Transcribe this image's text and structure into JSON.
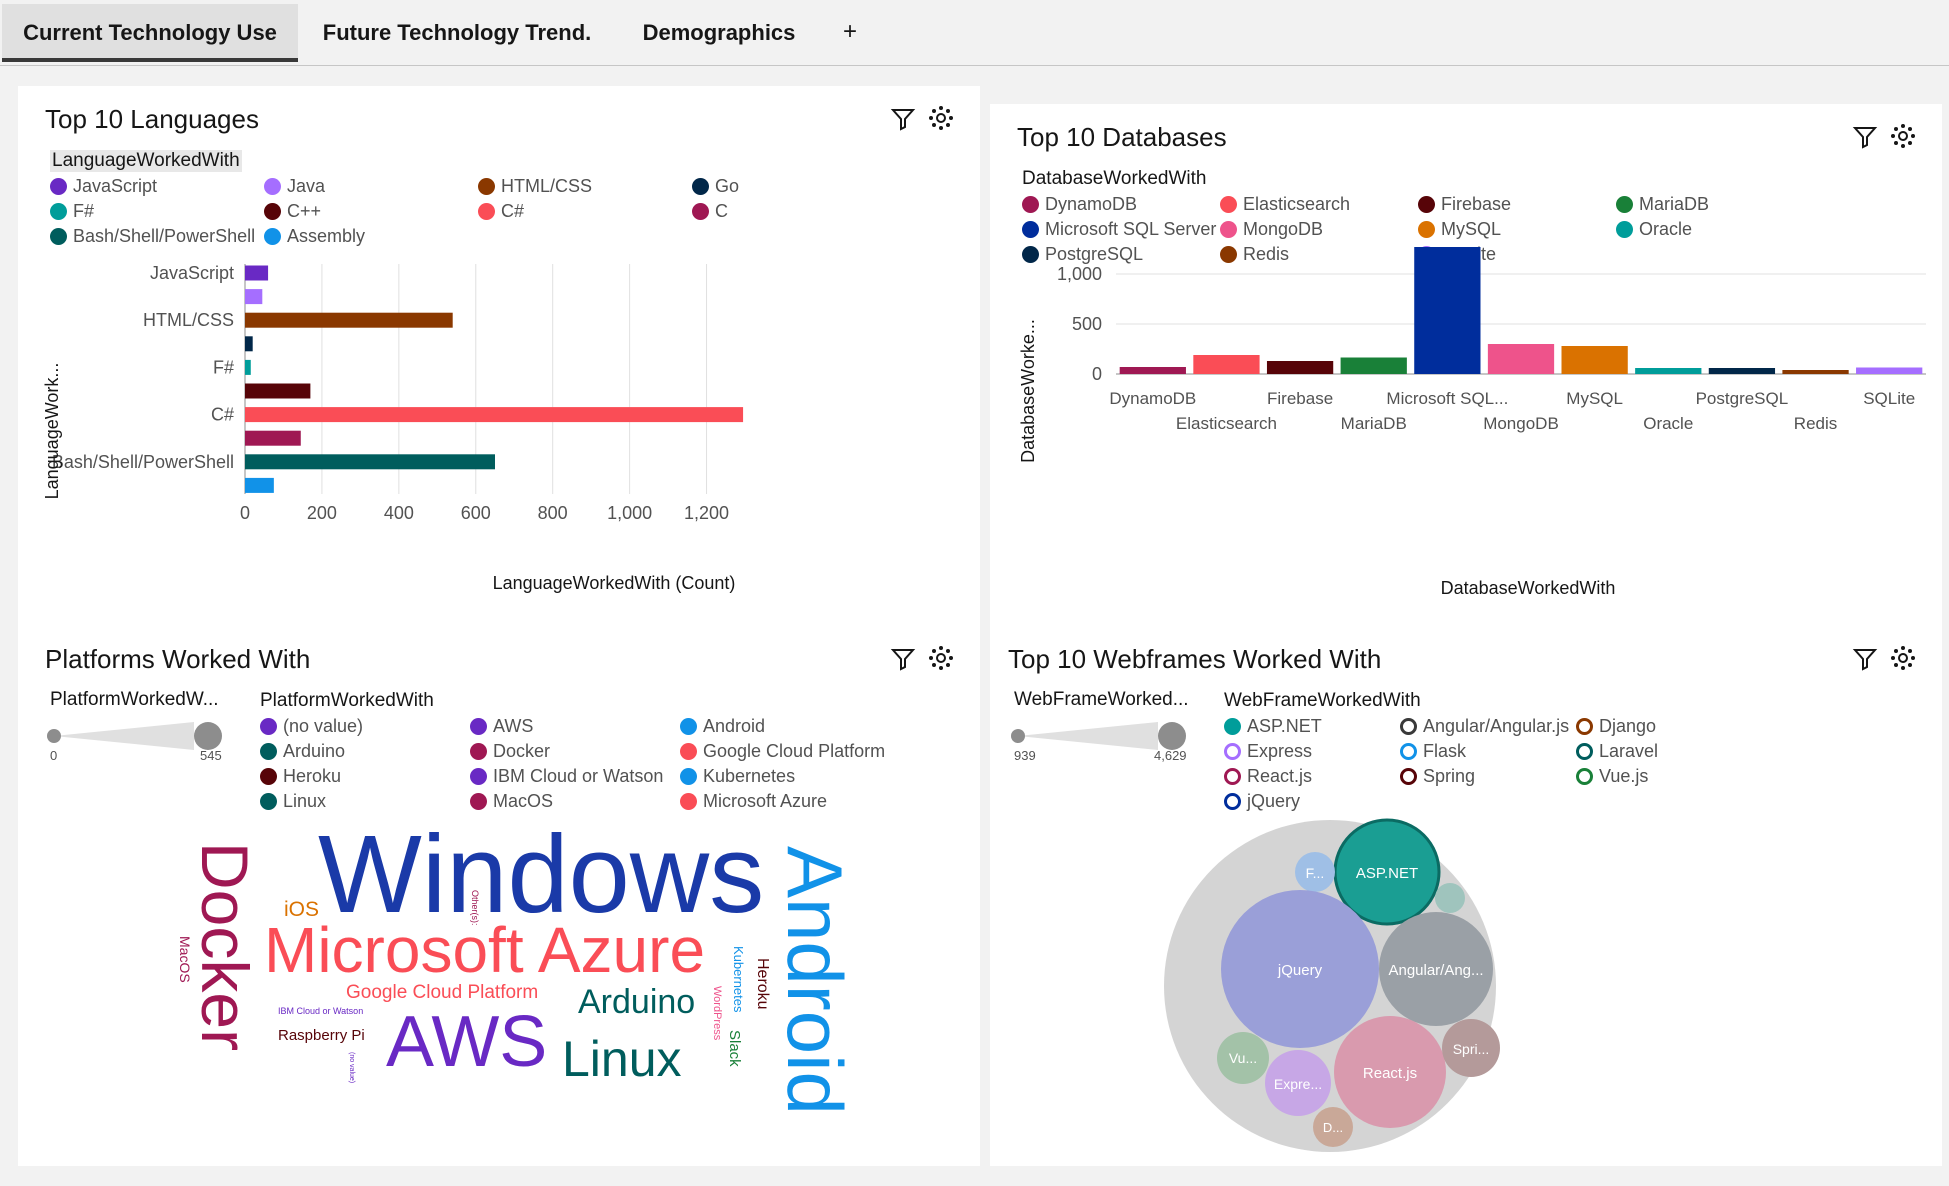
{
  "tabs": [
    {
      "label": "Current Technology Use",
      "active": true
    },
    {
      "label": "Future Technology Trend.",
      "active": false
    },
    {
      "label": "Demographics",
      "active": false
    }
  ],
  "add_tab_label": "+",
  "icons": {
    "filter": "filter-icon",
    "settings": "network-settings-icon"
  },
  "languages": {
    "title": "Top 10 Languages",
    "legend_title": "LanguageWorkedWith",
    "legend": [
      {
        "name": "JavaScript",
        "color": "#6929c4"
      },
      {
        "name": "Java",
        "color": "#a56eff"
      },
      {
        "name": "HTML/CSS",
        "color": "#8a3800"
      },
      {
        "name": "Go",
        "color": "#012749"
      },
      {
        "name": "F#",
        "color": "#1192e8"
      },
      {
        "name": "C++",
        "color": "#570408"
      },
      {
        "name": "C#",
        "color": "#fa4d56"
      },
      {
        "name": "C",
        "color": "#9f1853"
      },
      {
        "name": "Bash/Shell/PowerShell",
        "color": "#005d5d"
      },
      {
        "name": "Assembly",
        "color": "#1192e8"
      }
    ]
  },
  "databases": {
    "title": "Top 10 Databases",
    "legend_title": "DatabaseWorkedWith",
    "legend": [
      {
        "name": "DynamoDB",
        "color": "#9f1853"
      },
      {
        "name": "Elasticsearch",
        "color": "#fa4d56"
      },
      {
        "name": "Firebase",
        "color": "#570408"
      },
      {
        "name": "MariaDB",
        "color": "#198038"
      },
      {
        "name": "Microsoft SQL Server",
        "color": "#002d9c"
      },
      {
        "name": "MongoDB",
        "color": "#ee538b"
      },
      {
        "name": "MySQL",
        "color": "#da7200"
      },
      {
        "name": "Oracle",
        "color": "#009d9a"
      },
      {
        "name": "PostgreSQL",
        "color": "#012749"
      },
      {
        "name": "Redis",
        "color": "#8a3800"
      },
      {
        "name": "SQLite",
        "color": "#a56eff"
      }
    ]
  },
  "platforms": {
    "title": "Platforms Worked With",
    "range_label": "PlatformWorkedW...",
    "range_min": "0",
    "range_max": "545",
    "range_value": 1,
    "legend_title": "PlatformWorkedWith",
    "legend": [
      {
        "name": "(no value)",
        "color": "#6929c4"
      },
      {
        "name": "AWS",
        "color": "#6929c4"
      },
      {
        "name": "Android",
        "color": "#1192e8"
      },
      {
        "name": "Arduino",
        "color": "#005d5d"
      },
      {
        "name": "Docker",
        "color": "#9f1853"
      },
      {
        "name": "Google Cloud Platform",
        "color": "#fa4d56"
      },
      {
        "name": "Heroku",
        "color": "#570408"
      },
      {
        "name": "IBM Cloud or Watson",
        "color": "#6929c4"
      },
      {
        "name": "Kubernetes",
        "color": "#1192e8"
      },
      {
        "name": "Linux",
        "color": "#005d5d"
      },
      {
        "name": "MacOS",
        "color": "#9f1853"
      },
      {
        "name": "Microsoft Azure",
        "color": "#fa4d56"
      }
    ],
    "words": [
      {
        "text": "Windows",
        "color": "#1a3aa8"
      },
      {
        "text": "Microsoft Azure",
        "color": "#fa4d56"
      },
      {
        "text": "Android",
        "color": "#1192e8"
      },
      {
        "text": "Docker",
        "color": "#9f1853"
      },
      {
        "text": "AWS",
        "color": "#6929c4"
      },
      {
        "text": "Linux",
        "color": "#005d5d"
      },
      {
        "text": "Arduino",
        "color": "#005d5d"
      },
      {
        "text": "Google Cloud Platform",
        "color": "#fa4d56"
      },
      {
        "text": "iOS",
        "color": "#da7200"
      },
      {
        "text": "Raspberry Pi",
        "color": "#570408"
      },
      {
        "text": "IBM Cloud or Watson",
        "color": "#6929c4"
      },
      {
        "text": "MacOS",
        "color": "#9f1853"
      },
      {
        "text": "Heroku",
        "color": "#570408"
      },
      {
        "text": "Kubernetes",
        "color": "#1192e8"
      },
      {
        "text": "WordPress",
        "color": "#ee538b"
      },
      {
        "text": "Slack",
        "color": "#198038"
      },
      {
        "text": "Other(s):",
        "color": "#9f1853"
      },
      {
        "text": "(no value)",
        "color": "#6929c4"
      }
    ]
  },
  "webframes": {
    "title": "Top 10 Webframes Worked With",
    "range_label": "WebFrameWorked...",
    "range_min": "939",
    "range_max": "4,629",
    "range_value": 1,
    "legend_title": "WebFrameWorkedWith",
    "legend": [
      {
        "name": "ASP.NET",
        "color": "#009d9a"
      },
      {
        "name": "Angular/Angular.js",
        "color": "#393939"
      },
      {
        "name": "Django",
        "color": "#8a3800"
      },
      {
        "name": "Express",
        "color": "#a56eff"
      },
      {
        "name": "Flask",
        "color": "#1192e8"
      },
      {
        "name": "Laravel",
        "color": "#005d5d"
      },
      {
        "name": "React.js",
        "color": "#9f1853"
      },
      {
        "name": "Spring",
        "color": "#570408"
      },
      {
        "name": "Vue.js",
        "color": "#198038"
      },
      {
        "name": "jQuery",
        "color": "#002d9c"
      }
    ],
    "bubbles": [
      {
        "label": "ASP.NET",
        "color": "#1a9e93",
        "stroke": "#0b6b63"
      },
      {
        "label": "F...",
        "color": "#9fbfe6"
      },
      {
        "label": "",
        "color": "#9fc4bd"
      },
      {
        "label": "jQuery",
        "color": "#9a9fd8"
      },
      {
        "label": "Angular/Ang...",
        "color": "#9aa0a6"
      },
      {
        "label": "Vu...",
        "color": "#a3c2a8"
      },
      {
        "label": "Expre...",
        "color": "#c7a7e6"
      },
      {
        "label": "React.js",
        "color": "#d99aae"
      },
      {
        "label": "Spri...",
        "color": "#b49a9a"
      },
      {
        "label": "D...",
        "color": "#c9a898"
      }
    ]
  },
  "chart_data": [
    {
      "type": "bar",
      "orientation": "horizontal",
      "title": "Top 10 Languages",
      "xlabel": "LanguageWorkedWith (Count)",
      "ylabel": "LanguageWork...",
      "xlim": [
        0,
        1300
      ],
      "xticks": [
        "0",
        "200",
        "400",
        "600",
        "800",
        "1,000",
        "1,200"
      ],
      "visible_category_labels": [
        "JavaScript",
        "HTML/CSS",
        "F#",
        "C#",
        "Bash/Shell/PowerShell"
      ],
      "categories": [
        "JavaScript",
        "Java",
        "HTML/CSS",
        "Go",
        "F#",
        "C++",
        "C#",
        "C",
        "Bash/Shell/PowerShell",
        "Assembly"
      ],
      "values": [
        60,
        45,
        540,
        20,
        15,
        170,
        1295,
        145,
        650,
        75
      ],
      "colors": [
        "#6929c4",
        "#a56eff",
        "#8a3800",
        "#012749",
        "#009d9a",
        "#570408",
        "#fa4d56",
        "#9f1853",
        "#005d5d",
        "#1192e8"
      ]
    },
    {
      "type": "bar",
      "title": "Top 10 Databases",
      "xlabel": "DatabaseWorkedWith",
      "ylabel": "DatabaseWorke...",
      "ylim": [
        0,
        1300
      ],
      "yticks": [
        "0",
        "500",
        "1,000"
      ],
      "categories": [
        "DynamoDB",
        "Elasticsearch",
        "Firebase",
        "MariaDB",
        "Microsoft SQL...",
        "MongoDB",
        "MySQL",
        "Oracle",
        "PostgreSQL",
        "Redis",
        "SQLite"
      ],
      "values": [
        70,
        190,
        130,
        165,
        1270,
        300,
        280,
        60,
        60,
        40,
        65
      ],
      "colors": [
        "#9f1853",
        "#fa4d56",
        "#570408",
        "#198038",
        "#002d9c",
        "#ee538b",
        "#da7200",
        "#009d9a",
        "#012749",
        "#8a3800",
        "#a56eff"
      ]
    }
  ]
}
